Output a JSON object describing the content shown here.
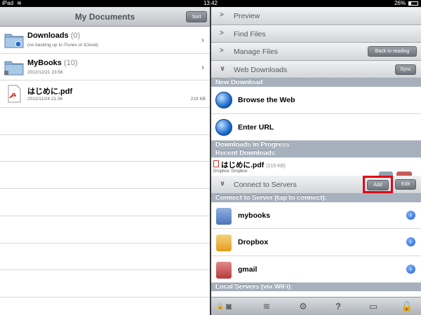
{
  "statusbar": {
    "device": "iPad",
    "time": "13:42",
    "battery": "26%"
  },
  "left": {
    "title": "My Documents",
    "sort_label": "Sort",
    "rows": [
      {
        "title": "Downloads",
        "count": "(0)",
        "sub": "(no backing up to iTunes or iCloud)",
        "size": "",
        "icon": "cloud-folder-icon"
      },
      {
        "title": "MyBooks",
        "count": "(10)",
        "sub": "2012/12/21 23:56",
        "size": "",
        "icon": "locked-folder-icon"
      },
      {
        "title": "はじめに.pdf",
        "count": "",
        "sub": "2012/11/24 21:36",
        "size": "219 KB",
        "icon": "pdf-file-icon"
      }
    ]
  },
  "right": {
    "sections": {
      "preview": "Preview",
      "find_files": "Find Files",
      "manage_files": "Manage Files",
      "back_to_reading": "Back to reading",
      "web_downloads": "Web Downloads",
      "sync": "Sync",
      "connect_to_servers": "Connect to Servers",
      "add": "Add",
      "edit": "Edit"
    },
    "bands": {
      "new_download": "New Download",
      "downloads_in_progress": "Downloads in Progress",
      "recent_downloads": "Recent Downloads",
      "connect_to_server": "Connect to Server (tap to connect):",
      "local_servers": "Local Servers (via WiFi):"
    },
    "new_download_items": {
      "browse": "Browse the Web",
      "enter_url": "Enter URL"
    },
    "recent": {
      "name": "はじめに.pdf",
      "size": "(219 KB)",
      "source": "Dropbox: Dropbox"
    },
    "servers": [
      {
        "label": "mybooks",
        "icon": "hard-drive-icon",
        "color": "#5b86c8"
      },
      {
        "label": "Dropbox",
        "icon": "dropbox-icon",
        "color": "#f0b23a"
      },
      {
        "label": "gmail",
        "icon": "gmail-icon",
        "color": "#c94b4b"
      }
    ]
  },
  "colors": {
    "highlight": "#e30016",
    "band": "#a6b1bd"
  }
}
